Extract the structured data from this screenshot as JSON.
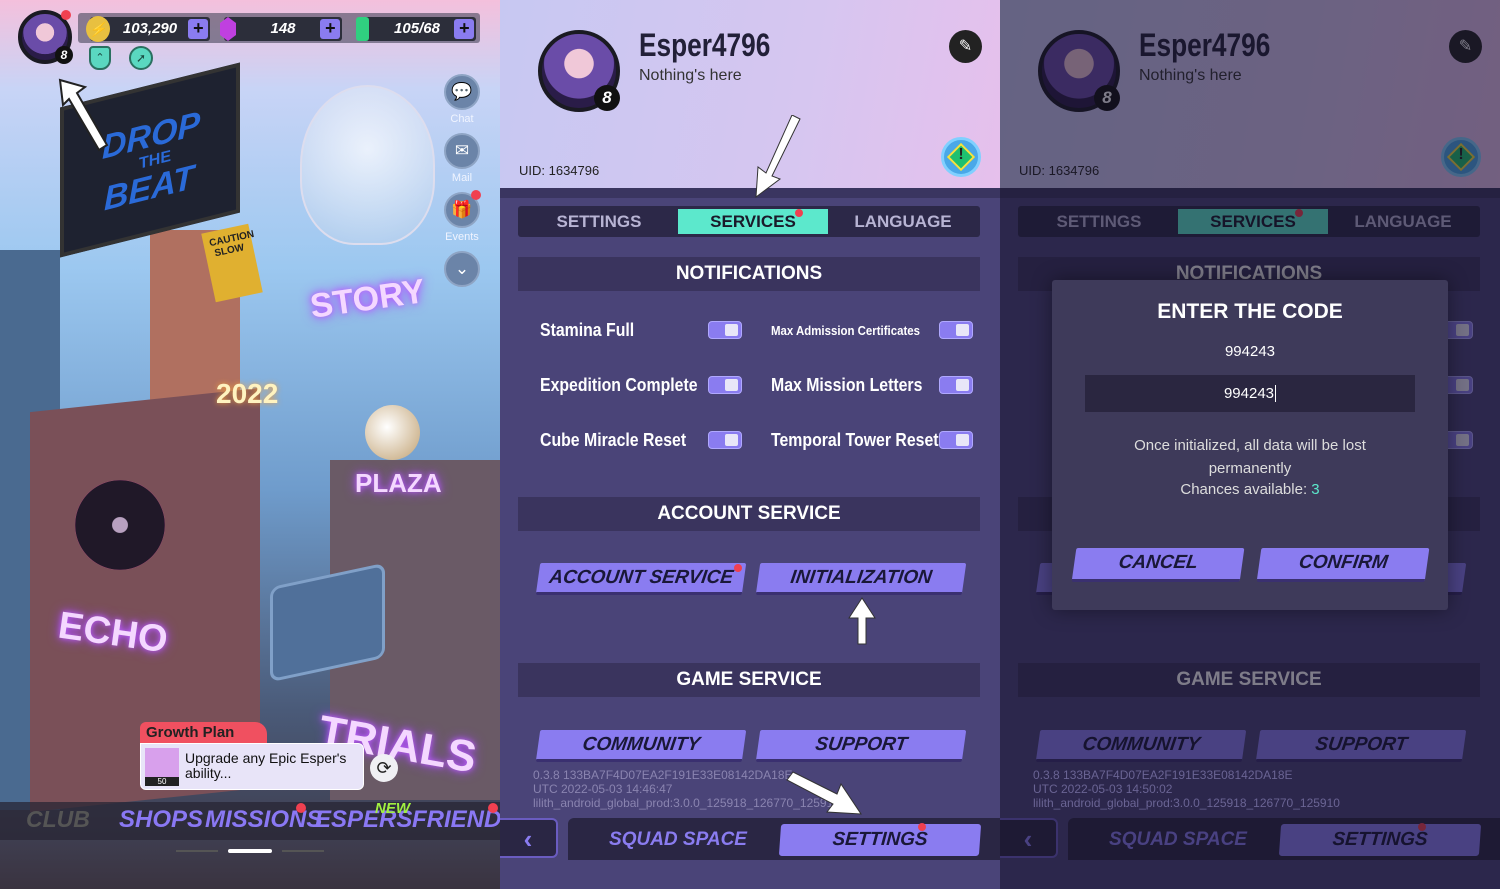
{
  "home": {
    "player_level": "8",
    "currencies": [
      {
        "icon": "coin-icon",
        "value": "103,290"
      },
      {
        "icon": "crystal-icon",
        "value": "148"
      },
      {
        "icon": "stamina-icon",
        "value": "105/68"
      }
    ],
    "side_buttons": [
      {
        "label": "Chat",
        "icon": "chat-icon"
      },
      {
        "label": "Mail",
        "icon": "mail-icon"
      },
      {
        "label": "Events",
        "icon": "gift-icon"
      }
    ],
    "signs": {
      "drop": "DROP",
      "the": "THE",
      "beat": "BEAT",
      "story": "STORY",
      "plaza": "PLAZA",
      "echo": "ECHO",
      "trials": "TRIALS",
      "year": "2022",
      "caution": "CAUTION SLOW"
    },
    "growth_plan": {
      "title": "Growth Plan",
      "text": "Upgrade any Epic Esper's ability...",
      "item_count": "50"
    },
    "nav": [
      {
        "label": "CLUB"
      },
      {
        "label": "SHOPS"
      },
      {
        "label": "MISSIONS"
      },
      {
        "label": "ESPERS",
        "badge": "NEW"
      },
      {
        "label": "FRIENDS"
      }
    ]
  },
  "profile": {
    "name": "Esper4796",
    "tagline": "Nothing's here",
    "uid": "UID: 1634796",
    "level": "8"
  },
  "tabs": [
    "SETTINGS",
    "SERVICES",
    "LANGUAGE"
  ],
  "notifications": {
    "title": "NOTIFICATIONS",
    "items": [
      "Stamina Full",
      "Max Admission Certificates",
      "Expedition Complete",
      "Max Mission Letters",
      "Cube Miracle Reset",
      "Temporal Tower Reset"
    ]
  },
  "account_service": {
    "title": "ACCOUNT SERVICE",
    "buttons": [
      "ACCOUNT SERVICE",
      "INITIALIZATION"
    ]
  },
  "game_service": {
    "title": "GAME SERVICE",
    "buttons": [
      "COMMUNITY",
      "SUPPORT"
    ]
  },
  "version_a": [
    "0.3.8 133BA7F4D07EA2F191E33E08142DA18E",
    "UTC 2022-05-03 14:46:47",
    "lilith_android_global_prod:3.0.0_125918_126770_125910"
  ],
  "version_b": [
    "0.3.8 133BA7F4D07EA2F191E33E08142DA18E",
    "UTC 2022-05-03 14:50:02",
    "lilith_android_global_prod:3.0.0_125918_126770_125910"
  ],
  "bottom_nav": [
    "SQUAD SPACE",
    "SETTINGS"
  ],
  "modal": {
    "title": "ENTER THE CODE",
    "code": "994243",
    "input_value": "994243",
    "warning": "Once initialized, all data will be lost permanently",
    "chances_label": "Chances available: ",
    "chances": "3",
    "cancel": "CANCEL",
    "confirm": "CONFIRM"
  },
  "colors": {
    "accent": "#8a7cf0",
    "active_tab": "#5ce8cc",
    "notification_dot": "#f04050",
    "chances": "#5ce8cc"
  }
}
